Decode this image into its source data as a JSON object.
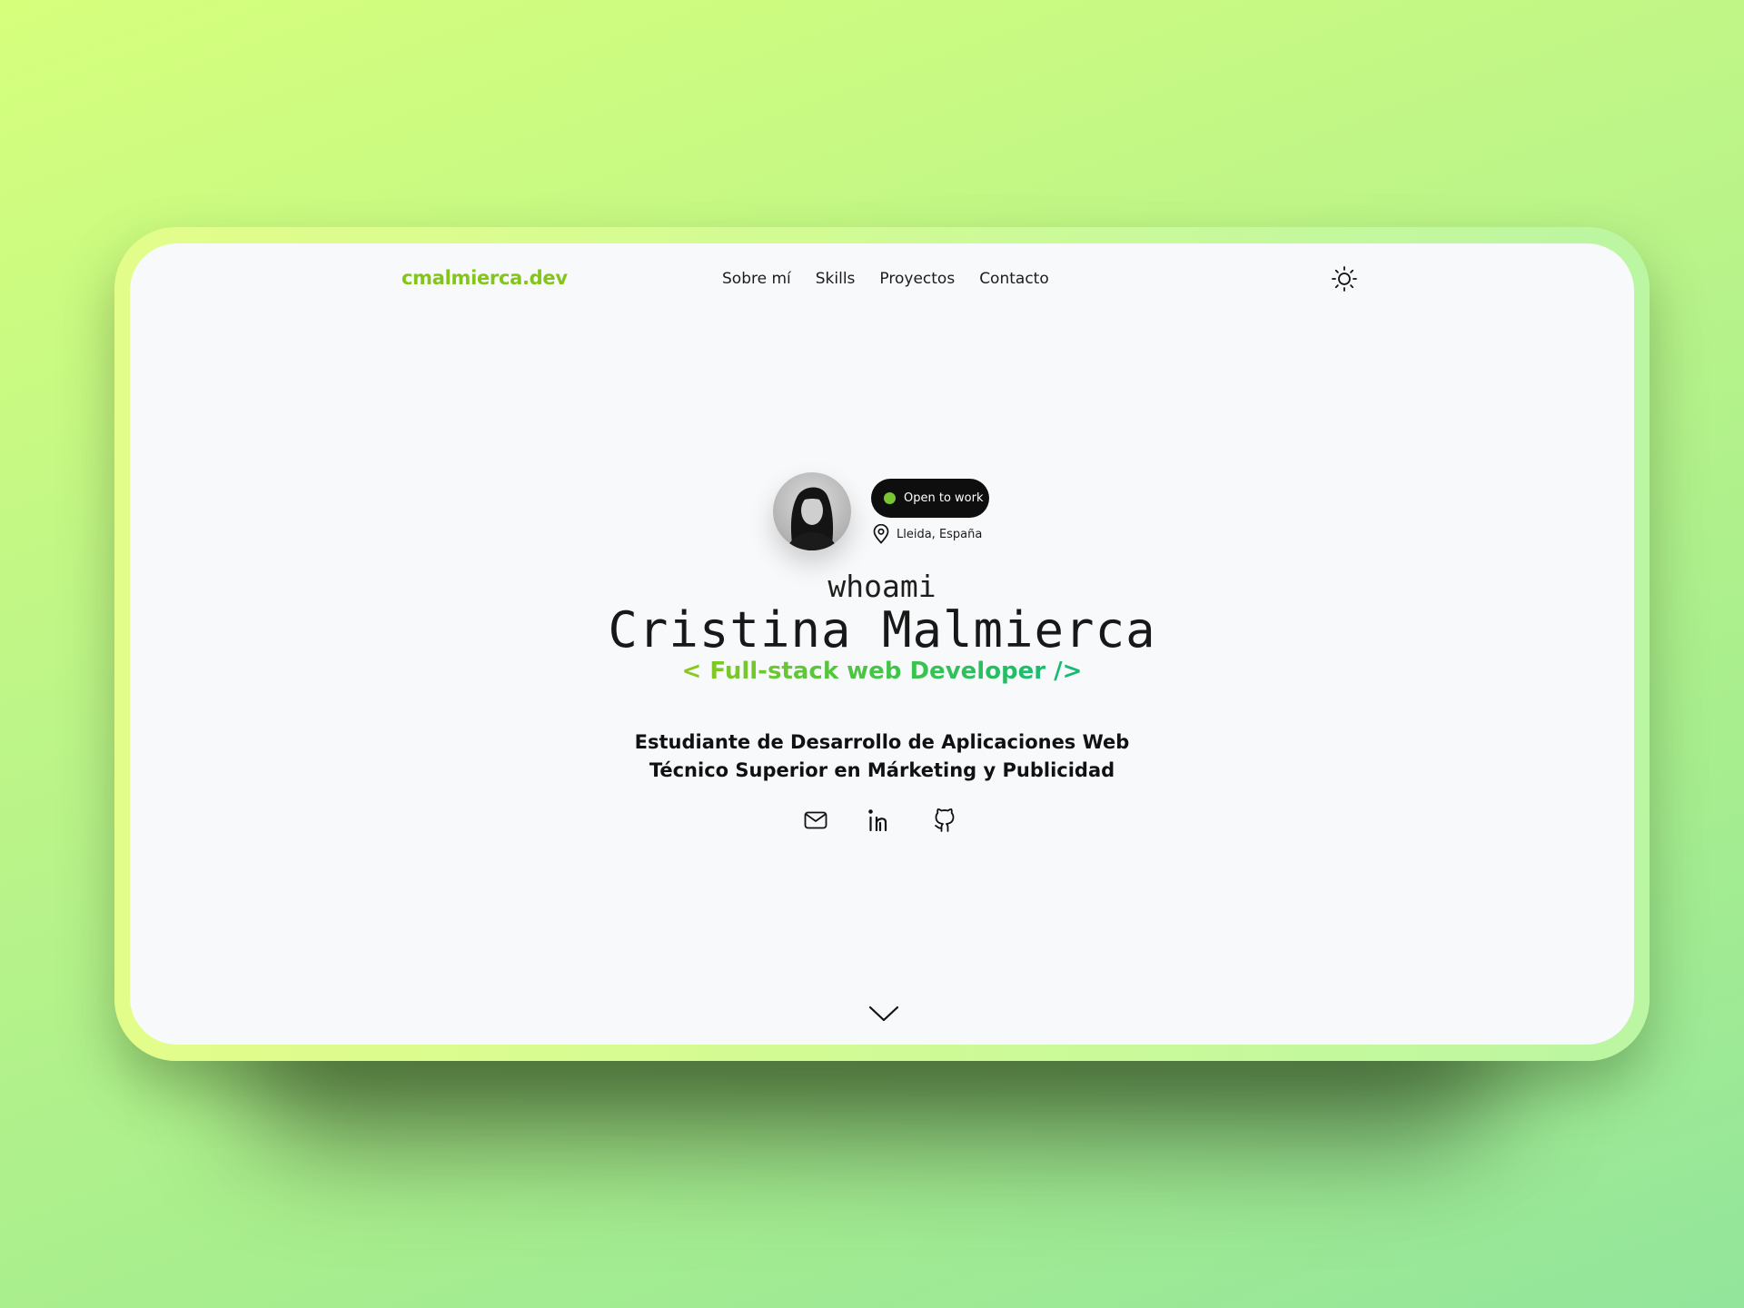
{
  "site": {
    "logo": "cmalmierca.dev",
    "nav": [
      "Sobre mí",
      "Skills",
      "Proyectos",
      "Contacto"
    ]
  },
  "hero": {
    "status_badge": "Open to work",
    "location": "Lleida, España",
    "whoami": "whoami",
    "name": "Cristina Malmierca",
    "role": "< Full-stack web Developer />",
    "description_line1": "Estudiante de Desarrollo de Aplicaciones Web",
    "description_line2": "Técnico Superior en Márketing y Publicidad"
  },
  "icons": [
    "sun-icon",
    "map-pin-icon",
    "mail-icon",
    "linkedin-icon",
    "github-icon",
    "chevron-down-icon"
  ],
  "colors": {
    "accent": "#84c51c",
    "status_dot": "#79c532",
    "badge_bg": "#0e0e0e",
    "page_bg": "#f8f9fa"
  }
}
